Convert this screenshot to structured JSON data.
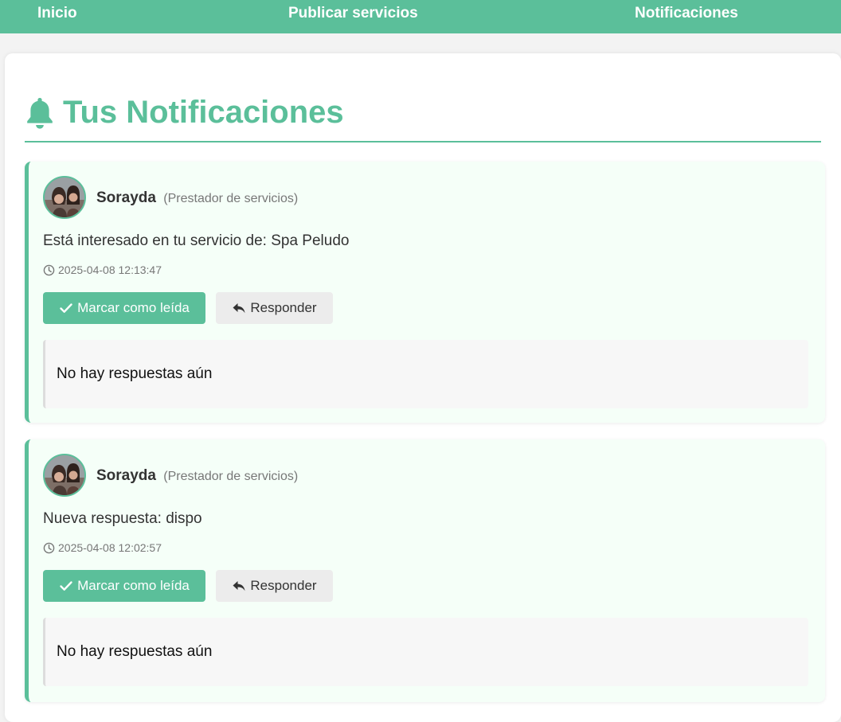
{
  "nav": {
    "inicio": "Inicio",
    "publicar": "Publicar servicios",
    "notificaciones": "Notificaciones"
  },
  "page": {
    "title": "Tus Notificaciones",
    "title_icon": "bell-icon"
  },
  "colors": {
    "accent": "#5bbf9a",
    "card_bg": "#f5fff8"
  },
  "notifications": [
    {
      "sender": "Sorayda",
      "role": "(Prestador de servicios)",
      "message": "Está interesado en tu servicio de: Spa Peludo",
      "timestamp": "2025-04-08 12:13:47",
      "mark_read_label": "Marcar como leída",
      "reply_label": "Responder",
      "replies_text": "No hay respuestas aún"
    },
    {
      "sender": "Sorayda",
      "role": "(Prestador de servicios)",
      "message": "Nueva respuesta: dispo",
      "timestamp": "2025-04-08 12:02:57",
      "mark_read_label": "Marcar como leída",
      "reply_label": "Responder",
      "replies_text": "No hay respuestas aún"
    }
  ]
}
